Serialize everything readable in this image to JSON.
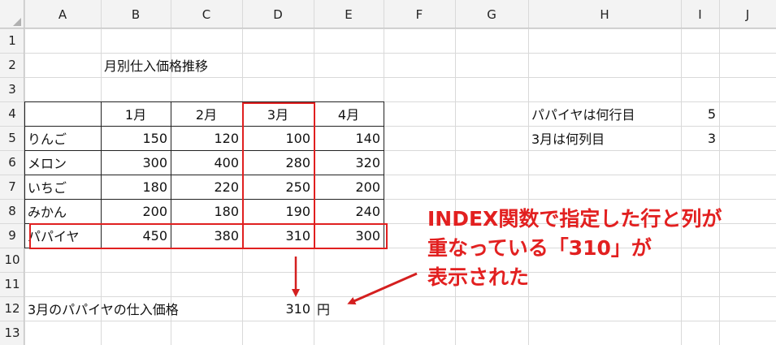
{
  "columns": [
    "A",
    "B",
    "C",
    "D",
    "E",
    "F",
    "G",
    "H",
    "I",
    "J"
  ],
  "rows": [
    "1",
    "2",
    "3",
    "4",
    "5",
    "6",
    "7",
    "8",
    "9",
    "10",
    "11",
    "12",
    "13"
  ],
  "title": "月別仕入価格推移",
  "table": {
    "months": [
      "1月",
      "2月",
      "3月",
      "4月"
    ],
    "fruits": [
      {
        "name": "りんご",
        "values": [
          "150",
          "120",
          "100",
          "140"
        ]
      },
      {
        "name": "メロン",
        "values": [
          "300",
          "400",
          "280",
          "320"
        ]
      },
      {
        "name": "いちご",
        "values": [
          "180",
          "220",
          "250",
          "200"
        ]
      },
      {
        "name": "みかん",
        "values": [
          "200",
          "180",
          "190",
          "240"
        ]
      },
      {
        "name": "パパイヤ",
        "values": [
          "450",
          "380",
          "310",
          "300"
        ]
      }
    ]
  },
  "lookup": {
    "row_label": "パパイヤは何行目",
    "row_value": "5",
    "col_label": "3月は何列目",
    "col_value": "3"
  },
  "result": {
    "label": "3月のパパイヤの仕入価格",
    "value": "310",
    "unit": "円"
  },
  "annotation": {
    "lines": [
      "INDEX関数で指定した行と列が",
      "重なっている「310」が",
      "表示された"
    ]
  },
  "colors": {
    "highlight": "#e02020",
    "annotation_text": "#e22020",
    "header_bg": "#f3f3f3"
  }
}
